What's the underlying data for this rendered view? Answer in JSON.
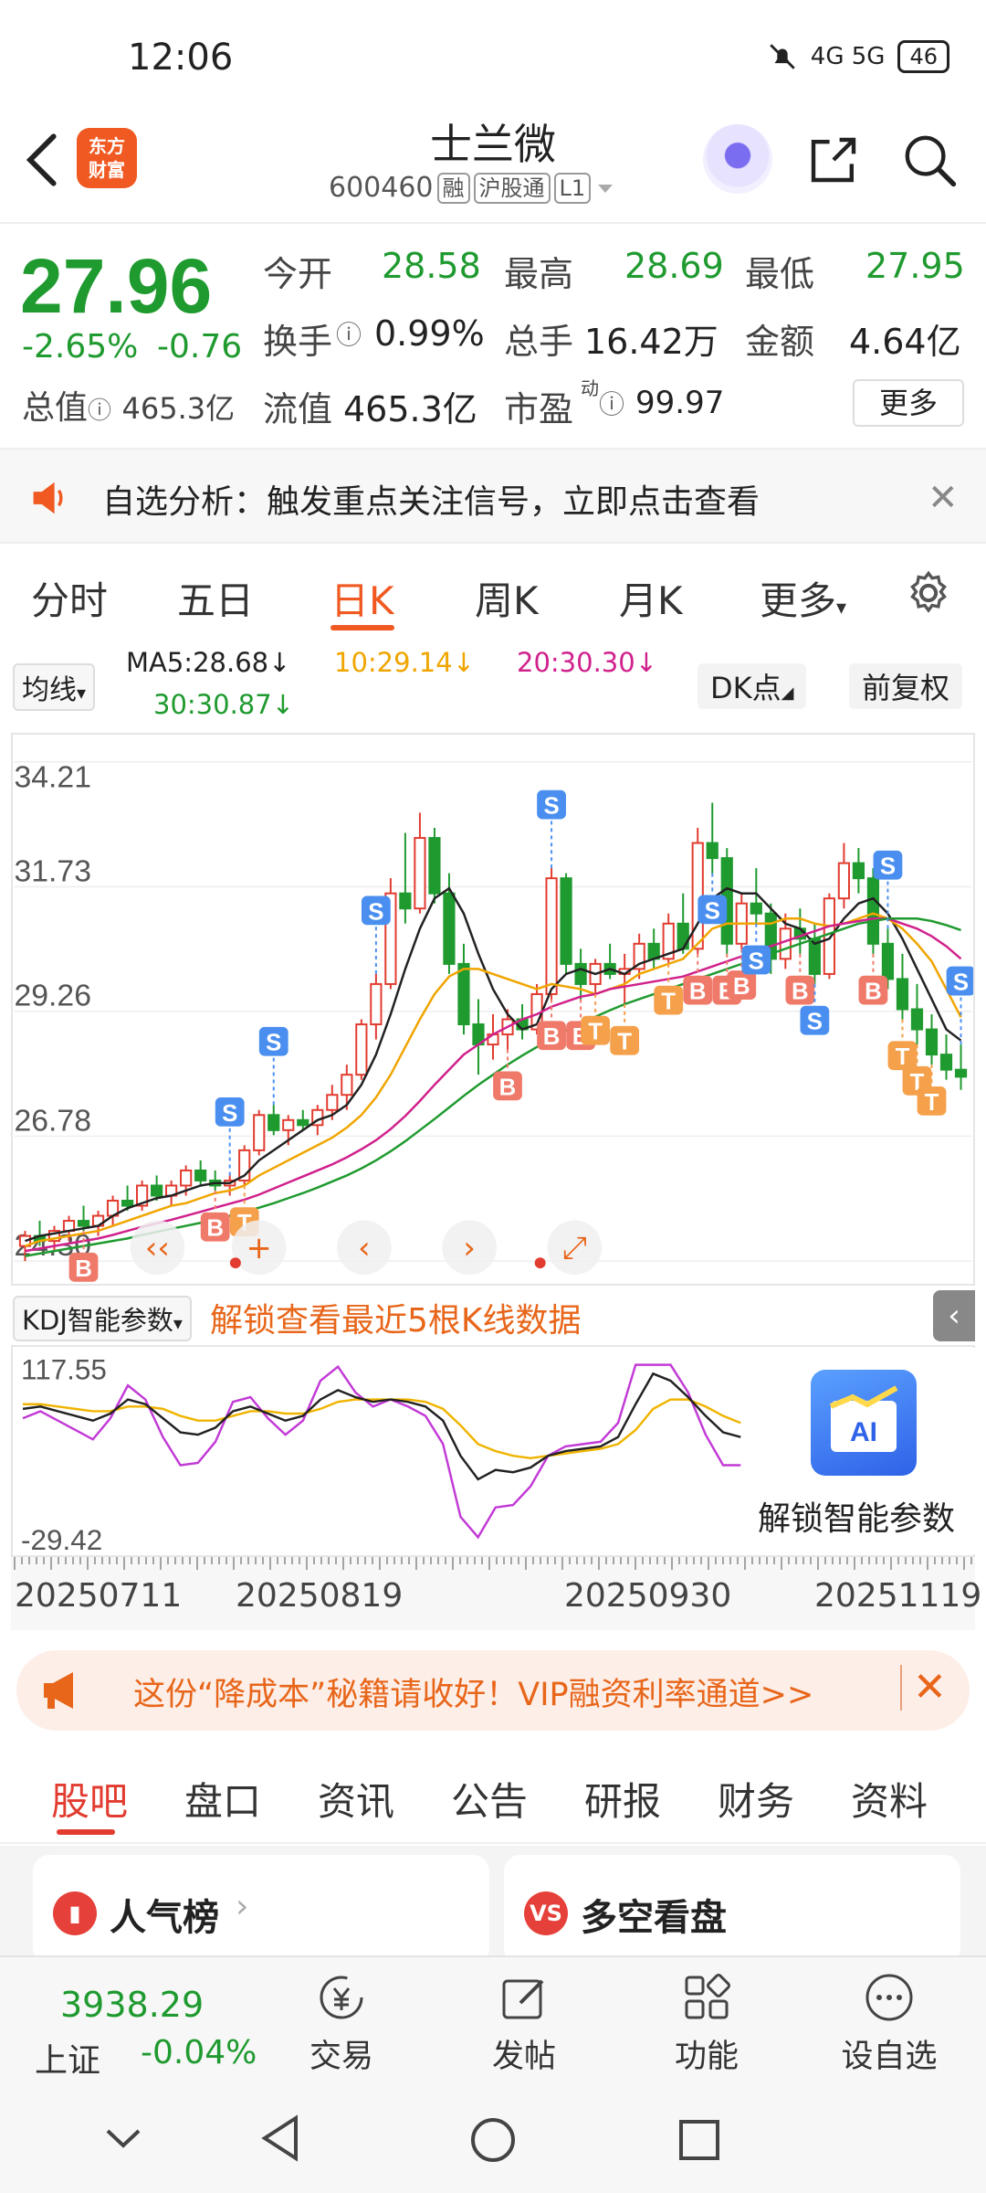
{
  "status_bar": {
    "time": "12:06",
    "network": "4G 5G",
    "battery": "46"
  },
  "header": {
    "logo_line1": "东方",
    "logo_line2": "财富",
    "stock_name": "士兰微",
    "stock_code": "600460",
    "tags": [
      "融",
      "沪股通",
      "L1"
    ]
  },
  "quote": {
    "price": "27.96",
    "change_pct": "-2.65%",
    "change_abs": "-0.76",
    "open_label": "今开",
    "open": "28.58",
    "high_label": "最高",
    "high": "28.69",
    "low_label": "最低",
    "low": "27.95",
    "turnover_label": "换手",
    "turnover": "0.99%",
    "volume_label": "总手",
    "volume": "16.42万",
    "amount_label": "金额",
    "amount": "4.64亿",
    "total_val_label": "总值",
    "total_val": "465.3亿",
    "float_val_label": "流值",
    "float_val": "465.3亿",
    "pe_label": "市盈",
    "pe_sup": "动",
    "pe": "99.97",
    "more": "更多"
  },
  "alert": {
    "text": "自选分析：触发重点关注信号，立即点击查看",
    "close": "✕"
  },
  "period_tabs": [
    "分时",
    "五日",
    "日K",
    "周K",
    "月K",
    "更多"
  ],
  "active_period": "日K",
  "ma": {
    "select": "均线",
    "ma5": "MA5:28.68",
    "ma10": "10:29.14",
    "ma20": "20:30.30",
    "ma30": "30:30.87",
    "dk": "DK点",
    "adjust": "前复权"
  },
  "chart_data": {
    "type": "candlestick",
    "y_ticks": [
      "34.21",
      "31.73",
      "29.26",
      "26.78",
      "24.30"
    ],
    "ylim": [
      24.3,
      34.21
    ],
    "x_labels": [
      "20250711",
      "20250819",
      "20250930",
      "20251119"
    ],
    "series": [
      {
        "name": "MA5",
        "color": "#222222"
      },
      {
        "name": "MA10",
        "color": "#f0a500"
      },
      {
        "name": "MA20",
        "color": "#d0218c"
      },
      {
        "name": "MA30",
        "color": "#1f9a2f"
      }
    ],
    "ohlc": [
      [
        24.6,
        24.9,
        24.3,
        24.8
      ],
      [
        24.8,
        25.1,
        24.6,
        24.7
      ],
      [
        24.7,
        25.0,
        24.5,
        24.9
      ],
      [
        24.9,
        25.2,
        24.7,
        25.1
      ],
      [
        25.1,
        25.4,
        24.9,
        25.0
      ],
      [
        25.0,
        25.3,
        24.8,
        25.2
      ],
      [
        25.2,
        25.6,
        25.0,
        25.5
      ],
      [
        25.5,
        25.8,
        25.3,
        25.4
      ],
      [
        25.4,
        25.9,
        25.3,
        25.8
      ],
      [
        25.8,
        26.0,
        25.5,
        25.6
      ],
      [
        25.6,
        25.9,
        25.4,
        25.8
      ],
      [
        25.8,
        26.2,
        25.6,
        26.1
      ],
      [
        26.1,
        26.3,
        25.8,
        25.9
      ],
      [
        25.9,
        26.1,
        25.7,
        25.8
      ],
      [
        25.8,
        26.0,
        25.6,
        25.9
      ],
      [
        25.9,
        26.6,
        25.8,
        26.5
      ],
      [
        26.5,
        27.3,
        26.4,
        27.2
      ],
      [
        27.2,
        27.4,
        26.8,
        26.9
      ],
      [
        26.9,
        27.2,
        26.6,
        27.1
      ],
      [
        27.1,
        27.3,
        26.9,
        27.0
      ],
      [
        27.0,
        27.4,
        26.8,
        27.3
      ],
      [
        27.3,
        27.8,
        27.1,
        27.6
      ],
      [
        27.6,
        28.2,
        27.3,
        28.0
      ],
      [
        28.0,
        29.1,
        27.9,
        29.0
      ],
      [
        29.0,
        30.0,
        28.7,
        29.8
      ],
      [
        29.8,
        31.9,
        29.7,
        31.6
      ],
      [
        31.6,
        32.8,
        31.0,
        31.3
      ],
      [
        31.3,
        33.2,
        31.2,
        32.7
      ],
      [
        32.7,
        32.9,
        31.4,
        31.6
      ],
      [
        31.6,
        32.0,
        30.0,
        30.2
      ],
      [
        30.2,
        30.6,
        28.8,
        29.0
      ],
      [
        29.0,
        29.5,
        28.0,
        28.6
      ],
      [
        28.6,
        29.2,
        28.3,
        28.8
      ],
      [
        28.8,
        29.3,
        28.5,
        29.1
      ],
      [
        29.1,
        29.4,
        28.7,
        28.9
      ],
      [
        28.9,
        29.8,
        28.8,
        29.6
      ],
      [
        29.6,
        32.1,
        29.5,
        31.9
      ],
      [
        31.9,
        32.0,
        30.0,
        30.2
      ],
      [
        30.2,
        30.5,
        29.5,
        29.8
      ],
      [
        29.8,
        30.3,
        29.6,
        30.2
      ],
      [
        30.2,
        30.6,
        29.9,
        30.0
      ],
      [
        30.0,
        30.4,
        29.4,
        30.1
      ],
      [
        30.1,
        30.8,
        29.9,
        30.6
      ],
      [
        30.6,
        30.9,
        30.1,
        30.3
      ],
      [
        30.3,
        31.2,
        30.2,
        31.0
      ],
      [
        31.0,
        31.6,
        30.4,
        30.5
      ],
      [
        30.5,
        32.9,
        30.4,
        32.6
      ],
      [
        32.6,
        33.4,
        32.0,
        32.3
      ],
      [
        32.3,
        32.5,
        30.4,
        30.6
      ],
      [
        30.6,
        31.6,
        30.5,
        31.4
      ],
      [
        31.4,
        32.1,
        31.0,
        31.2
      ],
      [
        31.2,
        31.4,
        30.0,
        30.3
      ],
      [
        30.3,
        31.2,
        30.1,
        30.9
      ],
      [
        30.9,
        31.3,
        30.4,
        30.7
      ],
      [
        30.7,
        31.0,
        29.8,
        30.0
      ],
      [
        30.0,
        31.6,
        29.9,
        31.5
      ],
      [
        31.5,
        32.6,
        31.3,
        32.2
      ],
      [
        32.2,
        32.5,
        31.6,
        31.9
      ],
      [
        31.9,
        32.1,
        30.4,
        30.6
      ],
      [
        30.6,
        30.9,
        29.7,
        29.9
      ],
      [
        29.9,
        30.4,
        29.1,
        29.3
      ],
      [
        29.3,
        29.8,
        28.6,
        28.9
      ],
      [
        28.9,
        29.2,
        28.2,
        28.4
      ],
      [
        28.4,
        28.8,
        27.9,
        28.1
      ],
      [
        28.1,
        28.6,
        27.7,
        27.96
      ]
    ],
    "ma5": [
      24.7,
      24.8,
      24.85,
      24.9,
      24.95,
      25.0,
      25.2,
      25.35,
      25.45,
      25.55,
      25.6,
      25.7,
      25.8,
      25.85,
      25.85,
      26.0,
      26.3,
      26.5,
      26.7,
      26.9,
      27.1,
      27.2,
      27.4,
      27.8,
      28.4,
      29.2,
      30.1,
      30.9,
      31.5,
      31.7,
      31.2,
      30.4,
      29.7,
      29.2,
      28.9,
      29.0,
      29.7,
      30.0,
      30.1,
      30.0,
      30.1,
      30.0,
      30.2,
      30.3,
      30.4,
      30.5,
      31.0,
      31.5,
      31.7,
      31.6,
      31.6,
      31.3,
      31.0,
      30.9,
      30.6,
      30.7,
      31.1,
      31.4,
      31.5,
      31.2,
      30.7,
      30.1,
      29.5,
      28.9,
      28.68
    ],
    "ma10": [
      24.6,
      24.7,
      24.75,
      24.8,
      24.85,
      24.9,
      25.0,
      25.1,
      25.2,
      25.3,
      25.4,
      25.45,
      25.55,
      25.65,
      25.7,
      25.8,
      26.0,
      26.15,
      26.3,
      26.45,
      26.6,
      26.75,
      26.95,
      27.2,
      27.55,
      28.0,
      28.55,
      29.1,
      29.6,
      29.95,
      30.1,
      30.1,
      30.0,
      29.9,
      29.8,
      29.7,
      29.8,
      29.75,
      29.7,
      29.6,
      29.7,
      29.8,
      30.0,
      30.1,
      30.2,
      30.3,
      30.6,
      30.9,
      31.0,
      31.0,
      31.0,
      31.0,
      31.1,
      31.1,
      31.0,
      30.95,
      31.0,
      31.1,
      31.2,
      31.1,
      30.9,
      30.6,
      30.25,
      29.7,
      29.14
    ],
    "ma20": [
      24.5,
      24.55,
      24.6,
      24.65,
      24.7,
      24.75,
      24.82,
      24.9,
      24.98,
      25.05,
      25.12,
      25.2,
      25.28,
      25.36,
      25.44,
      25.52,
      25.62,
      25.74,
      25.86,
      25.98,
      26.1,
      26.22,
      26.36,
      26.52,
      26.7,
      26.92,
      27.18,
      27.48,
      27.8,
      28.1,
      28.4,
      28.6,
      28.8,
      28.95,
      29.1,
      29.2,
      29.35,
      29.45,
      29.55,
      29.6,
      29.7,
      29.75,
      29.8,
      29.85,
      29.9,
      29.95,
      30.05,
      30.15,
      30.25,
      30.35,
      30.45,
      30.55,
      30.65,
      30.75,
      30.85,
      30.95,
      31.0,
      31.05,
      31.1,
      31.1,
      31.0,
      30.9,
      30.75,
      30.55,
      30.3
    ],
    "ma30": [
      24.4,
      24.45,
      24.5,
      24.55,
      24.6,
      24.65,
      24.7,
      24.75,
      24.82,
      24.88,
      24.94,
      25.0,
      25.06,
      25.12,
      25.2,
      25.28,
      25.36,
      25.45,
      25.55,
      25.65,
      25.76,
      25.88,
      26.0,
      26.14,
      26.3,
      26.48,
      26.68,
      26.9,
      27.12,
      27.35,
      27.58,
      27.8,
      28.0,
      28.2,
      28.38,
      28.55,
      28.72,
      28.88,
      29.02,
      29.15,
      29.28,
      29.4,
      29.5,
      29.6,
      29.7,
      29.8,
      29.9,
      30.0,
      30.1,
      30.2,
      30.3,
      30.4,
      30.5,
      30.6,
      30.7,
      30.8,
      30.9,
      31.0,
      31.05,
      31.1,
      31.1,
      31.1,
      31.05,
      30.97,
      30.87
    ],
    "signals": [
      {
        "i": 4,
        "t": "B",
        "c": "#f07a6a",
        "p": "below"
      },
      {
        "i": 13,
        "t": "B",
        "c": "#f07a6a",
        "p": "below"
      },
      {
        "i": 15,
        "t": "T",
        "c": "#f5a04a",
        "p": "below"
      },
      {
        "i": 14,
        "t": "S",
        "c": "#4a8ff0",
        "p": "above"
      },
      {
        "i": 17,
        "t": "S",
        "c": "#4a8ff0",
        "p": "above"
      },
      {
        "i": 24,
        "t": "S",
        "c": "#4a8ff0",
        "p": "above"
      },
      {
        "i": 33,
        "t": "B",
        "c": "#f07a6a",
        "p": "below"
      },
      {
        "i": 36,
        "t": "S",
        "c": "#4a8ff0",
        "p": "above"
      },
      {
        "i": 36,
        "t": "B",
        "c": "#f07a6a",
        "p": "below"
      },
      {
        "i": 38,
        "t": "B",
        "c": "#f07a6a",
        "p": "below"
      },
      {
        "i": 39,
        "t": "T",
        "c": "#f5a04a",
        "p": "below"
      },
      {
        "i": 41,
        "t": "T",
        "c": "#f5a04a",
        "p": "below"
      },
      {
        "i": 44,
        "t": "T",
        "c": "#f5a04a",
        "p": "below"
      },
      {
        "i": 46,
        "t": "B",
        "c": "#f07a6a",
        "p": "below"
      },
      {
        "i": 47,
        "t": "S",
        "c": "#4a8ff0",
        "p": "below"
      },
      {
        "i": 48,
        "t": "B",
        "c": "#f07a6a",
        "p": "below"
      },
      {
        "i": 49,
        "t": "B",
        "c": "#f07a6a",
        "p": "below"
      },
      {
        "i": 50,
        "t": "S",
        "c": "#4a8ff0",
        "p": "below"
      },
      {
        "i": 53,
        "t": "B",
        "c": "#f07a6a",
        "p": "below"
      },
      {
        "i": 54,
        "t": "S",
        "c": "#4a8ff0",
        "p": "below"
      },
      {
        "i": 58,
        "t": "B",
        "c": "#f07a6a",
        "p": "below"
      },
      {
        "i": 60,
        "t": "T",
        "c": "#f5a04a",
        "p": "below"
      },
      {
        "i": 61,
        "t": "T",
        "c": "#f5a04a",
        "p": "below"
      },
      {
        "i": 62,
        "t": "T",
        "c": "#f5a04a",
        "p": "below"
      },
      {
        "i": 59,
        "t": "S",
        "c": "#4a8ff0",
        "p": "above"
      },
      {
        "i": 64,
        "t": "S",
        "c": "#4a8ff0",
        "p": "above"
      }
    ]
  },
  "kdj": {
    "select": "KDJ智能参数",
    "unlock_text": "解锁查看最近5根K线数据",
    "y_ticks": [
      "117.55",
      "-29.42"
    ],
    "ylim": [
      -29.42,
      117.55
    ],
    "K": [
      80,
      82,
      78,
      74,
      70,
      76,
      88,
      84,
      72,
      60,
      58,
      64,
      78,
      82,
      76,
      70,
      74,
      88,
      96,
      90,
      86,
      88,
      86,
      82,
      70,
      40,
      20,
      28,
      26,
      30,
      40,
      44,
      46,
      48,
      56,
      84,
      110,
      104,
      90,
      74,
      60,
      56
    ],
    "D": [
      84,
      84,
      82,
      80,
      78,
      78,
      82,
      82,
      80,
      74,
      70,
      70,
      74,
      78,
      78,
      76,
      76,
      80,
      86,
      88,
      88,
      88,
      88,
      86,
      80,
      66,
      50,
      44,
      40,
      38,
      40,
      42,
      44,
      46,
      50,
      62,
      80,
      88,
      88,
      82,
      74,
      68
    ],
    "J": [
      72,
      78,
      70,
      62,
      54,
      72,
      100,
      88,
      56,
      32,
      34,
      52,
      86,
      90,
      72,
      58,
      70,
      104,
      116,
      94,
      82,
      88,
      82,
      74,
      50,
      -12,
      -40,
      -4,
      -2,
      14,
      40,
      48,
      50,
      52,
      68,
      128,
      170,
      136,
      94,
      58,
      32,
      32
    ],
    "ai_label": "解锁智能参数"
  },
  "promo": {
    "text": "这份“降成本”秘籍请收好！VIP融资利率通道>>",
    "close": "✕"
  },
  "info_tabs": [
    "股吧",
    "盘口",
    "资讯",
    "公告",
    "研报",
    "财务",
    "资料"
  ],
  "cards": [
    {
      "title": "人气榜",
      "icon": "chart-icon"
    },
    {
      "title": "多空看盘",
      "icon": "vs-icon"
    }
  ],
  "bottom_nav": {
    "index_value": "3938.29",
    "index_name": "上证",
    "index_change": "-0.04%",
    "items": [
      "交易",
      "发帖",
      "功能",
      "设自选"
    ]
  }
}
